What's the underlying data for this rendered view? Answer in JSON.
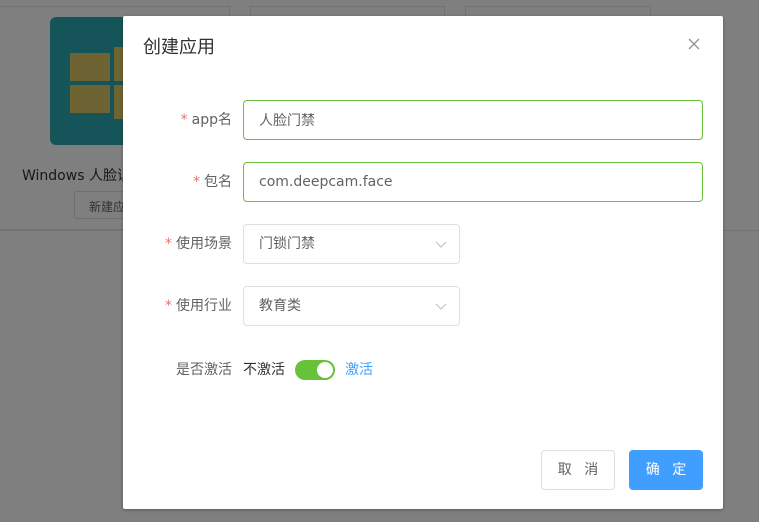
{
  "background": {
    "card_title": "Windows 人脸识",
    "card_button": "新建应",
    "tile_color": "#2aa9b0"
  },
  "dialog": {
    "title": "创建应用",
    "close_icon": "close-icon",
    "fields": {
      "app_name": {
        "label": "app名",
        "required": true,
        "value": "人脸门禁"
      },
      "package_name": {
        "label": "包名",
        "required": true,
        "value": "com.deepcam.face"
      },
      "scenario": {
        "label": "使用场景",
        "required": true,
        "value": "门锁门禁"
      },
      "industry": {
        "label": "使用行业",
        "required": true,
        "value": "教育类"
      },
      "activate": {
        "label": "是否激活",
        "inactive_text": "不激活",
        "active_text": "激活",
        "on": true
      }
    },
    "required_mark": "*",
    "buttons": {
      "cancel": "取 消",
      "confirm": "确 定"
    }
  },
  "colors": {
    "accent": "#409eff",
    "success": "#67c23a",
    "required": "#f56c6c"
  }
}
